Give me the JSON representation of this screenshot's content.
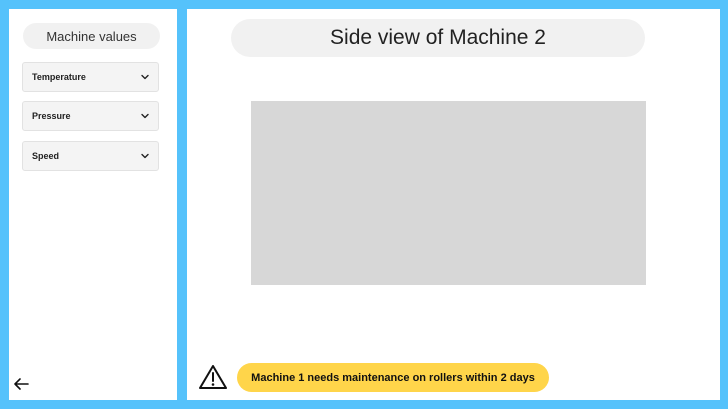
{
  "sidebar": {
    "title": "Machine values",
    "dropdowns": [
      {
        "label": "Temperature",
        "icon": "chevron-down-icon"
      },
      {
        "label": "Pressure",
        "icon": "chevron-down-icon"
      },
      {
        "label": "Speed",
        "icon": "chevron-down-icon"
      }
    ],
    "back_icon": "arrow-left-icon"
  },
  "main": {
    "title": "Side view of Machine 2",
    "alert": {
      "icon": "warning-icon",
      "message": "Machine 1 needs maintenance on rollers within 2 days",
      "color": "#ffd54a"
    }
  },
  "colors": {
    "frame": "#55c2fb",
    "panel": "#ffffff",
    "placeholder": "#d7d7d7"
  }
}
